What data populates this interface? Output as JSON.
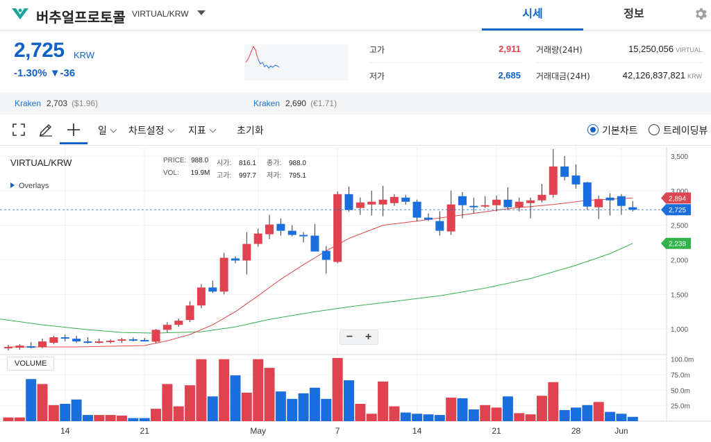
{
  "header": {
    "coin_name": "버추얼프로토콜",
    "pair": "VIRTUAL/KRW",
    "tabs": [
      {
        "label": "시세",
        "active": true
      },
      {
        "label": "정보",
        "active": false
      }
    ]
  },
  "summary": {
    "price": "2,725",
    "unit": "KRW",
    "change": "-1.30% ▼-36",
    "high_label": "고가",
    "high_value": "2,911",
    "low_label": "저가",
    "low_value": "2,685",
    "volume_label": "거래량(24H)",
    "volume_value": "15,250,056",
    "volume_unit": "VIRTUAL",
    "amount_label": "거래대금(24H)",
    "amount_value": "42,126,837,821",
    "amount_unit": "KRW"
  },
  "exchanges": [
    {
      "name": "Kraken",
      "price": "2,703",
      "usd": "($1.96)"
    },
    {
      "name": "Kraken",
      "price": "2,690",
      "usd": "(€1.71)"
    }
  ],
  "toolbar": {
    "period": "일",
    "chart_settings": "차트설정",
    "indicators": "지표",
    "reset": "초기화",
    "basic_chart": "기본차트",
    "trading_view": "트레이딩뷰"
  },
  "chart_header": {
    "symbol": "VIRTUAL/KRW",
    "overlays": "Overlays",
    "legend": {
      "price_label": "PRICE:",
      "price": "988.0",
      "open_label": "시가:",
      "open": "816.1",
      "close_label": "종가:",
      "close": "988.0",
      "vol_label": "VOL:",
      "vol": "19.9M",
      "high_label": "고가:",
      "high": "997.7",
      "low_label": "저가:",
      "low": "795.1"
    },
    "zoom_out": "−",
    "zoom_in": "+",
    "volume_tag": "VOLUME"
  },
  "colors": {
    "up": "#e0434f",
    "down": "#1b6fdd",
    "ma_short": "#e04848",
    "ma_long": "#33b24a",
    "accent": "#1261c4"
  },
  "chart_data": {
    "type": "candlestick",
    "price_axis": {
      "ticks": [
        "3,500",
        "3,000",
        "2,500",
        "2,000",
        "1,500",
        "1,000"
      ],
      "values": [
        3500,
        3000,
        2500,
        2000,
        1500,
        1000
      ],
      "range": [
        630,
        3640
      ]
    },
    "volume_axis": {
      "ticks": [
        "100.0m",
        "75.0m",
        "50.0m",
        "25.0m"
      ],
      "values": [
        100,
        75,
        50,
        25
      ],
      "range": [
        0,
        103
      ]
    },
    "x_ticks": [
      {
        "label": "14",
        "index": 5
      },
      {
        "label": "21",
        "index": 12
      },
      {
        "label": "May",
        "index": 22
      },
      {
        "label": "7",
        "index": 29
      },
      {
        "label": "14",
        "index": 36
      },
      {
        "label": "21",
        "index": 43
      },
      {
        "label": "28",
        "index": 50
      },
      {
        "label": "Jun",
        "index": 54
      }
    ],
    "current_price_label": "2,725",
    "current_price": 2725,
    "ma_short_label": "2,894",
    "ma_short_last": 2894,
    "ma_long_label": "2,238",
    "ma_long_last": 2238,
    "candles": [
      {
        "o": 720,
        "h": 770,
        "l": 690,
        "c": 740,
        "v": 6
      },
      {
        "o": 730,
        "h": 780,
        "l": 700,
        "c": 760,
        "v": 6
      },
      {
        "o": 750,
        "h": 810,
        "l": 720,
        "c": 740,
        "v": 68
      },
      {
        "o": 740,
        "h": 860,
        "l": 720,
        "c": 820,
        "v": 60
      },
      {
        "o": 800,
        "h": 900,
        "l": 780,
        "c": 880,
        "v": 26
      },
      {
        "o": 880,
        "h": 920,
        "l": 820,
        "c": 860,
        "v": 28
      },
      {
        "o": 860,
        "h": 900,
        "l": 800,
        "c": 820,
        "v": 35
      },
      {
        "o": 820,
        "h": 880,
        "l": 790,
        "c": 810,
        "v": 10
      },
      {
        "o": 810,
        "h": 860,
        "l": 790,
        "c": 820,
        "v": 10
      },
      {
        "o": 820,
        "h": 850,
        "l": 790,
        "c": 830,
        "v": 10
      },
      {
        "o": 830,
        "h": 870,
        "l": 800,
        "c": 850,
        "v": 9
      },
      {
        "o": 850,
        "h": 880,
        "l": 820,
        "c": 840,
        "v": 5
      },
      {
        "o": 840,
        "h": 870,
        "l": 820,
        "c": 835,
        "v": 5
      },
      {
        "o": 816,
        "h": 998,
        "l": 795,
        "c": 988,
        "v": 20
      },
      {
        "o": 988,
        "h": 1100,
        "l": 950,
        "c": 1060,
        "v": 60
      },
      {
        "o": 1060,
        "h": 1150,
        "l": 1030,
        "c": 1120,
        "v": 24
      },
      {
        "o": 1130,
        "h": 1400,
        "l": 1100,
        "c": 1340,
        "v": 58
      },
      {
        "o": 1340,
        "h": 1650,
        "l": 1300,
        "c": 1600,
        "v": 100
      },
      {
        "o": 1600,
        "h": 1700,
        "l": 1520,
        "c": 1540,
        "v": 40
      },
      {
        "o": 1540,
        "h": 2100,
        "l": 1500,
        "c": 2030,
        "v": 100
      },
      {
        "o": 2020,
        "h": 2050,
        "l": 1950,
        "c": 1990,
        "v": 74
      },
      {
        "o": 1990,
        "h": 2400,
        "l": 1790,
        "c": 2230,
        "v": 46
      },
      {
        "o": 2230,
        "h": 2450,
        "l": 2190,
        "c": 2380,
        "v": 100
      },
      {
        "o": 2370,
        "h": 2650,
        "l": 2300,
        "c": 2510,
        "v": 86
      },
      {
        "o": 2520,
        "h": 2600,
        "l": 2350,
        "c": 2420,
        "v": 48
      },
      {
        "o": 2420,
        "h": 2500,
        "l": 2340,
        "c": 2360,
        "v": 36
      },
      {
        "o": 2360,
        "h": 2400,
        "l": 2250,
        "c": 2350,
        "v": 45
      },
      {
        "o": 2350,
        "h": 2520,
        "l": 2300,
        "c": 2120,
        "v": 54
      },
      {
        "o": 2130,
        "h": 2200,
        "l": 1800,
        "c": 2000,
        "v": 36
      },
      {
        "o": 1970,
        "h": 2990,
        "l": 1950,
        "c": 2950,
        "v": 102
      },
      {
        "o": 2950,
        "h": 3060,
        "l": 2700,
        "c": 2720,
        "v": 66
      },
      {
        "o": 2750,
        "h": 2900,
        "l": 2650,
        "c": 2830,
        "v": 28
      },
      {
        "o": 2800,
        "h": 3000,
        "l": 2640,
        "c": 2840,
        "v": 12
      },
      {
        "o": 2800,
        "h": 3070,
        "l": 2630,
        "c": 2870,
        "v": 64
      },
      {
        "o": 2820,
        "h": 2950,
        "l": 2780,
        "c": 2910,
        "v": 24
      },
      {
        "o": 2900,
        "h": 2940,
        "l": 2800,
        "c": 2840,
        "v": 14
      },
      {
        "o": 2840,
        "h": 2870,
        "l": 2560,
        "c": 2610,
        "v": 12
      },
      {
        "o": 2610,
        "h": 2670,
        "l": 2560,
        "c": 2580,
        "v": 11
      },
      {
        "o": 2560,
        "h": 2700,
        "l": 2350,
        "c": 2420,
        "v": 10
      },
      {
        "o": 2410,
        "h": 3000,
        "l": 2360,
        "c": 2800,
        "v": 38
      },
      {
        "o": 2920,
        "h": 2980,
        "l": 2600,
        "c": 2790,
        "v": 37
      },
      {
        "o": 2780,
        "h": 2900,
        "l": 2670,
        "c": 2760,
        "v": 19
      },
      {
        "o": 2770,
        "h": 2920,
        "l": 2750,
        "c": 2790,
        "v": 26
      },
      {
        "o": 2790,
        "h": 2930,
        "l": 2700,
        "c": 2870,
        "v": 22
      },
      {
        "o": 2870,
        "h": 3050,
        "l": 2720,
        "c": 2760,
        "v": 40
      },
      {
        "o": 2760,
        "h": 2900,
        "l": 2700,
        "c": 2840,
        "v": 13
      },
      {
        "o": 2820,
        "h": 2900,
        "l": 2600,
        "c": 2860,
        "v": 11
      },
      {
        "o": 2860,
        "h": 3100,
        "l": 2830,
        "c": 2940,
        "v": 41
      },
      {
        "o": 2940,
        "h": 3600,
        "l": 2900,
        "c": 3350,
        "v": 63
      },
      {
        "o": 3350,
        "h": 3500,
        "l": 3150,
        "c": 3200,
        "v": 18
      },
      {
        "o": 3220,
        "h": 3380,
        "l": 3030,
        "c": 3090,
        "v": 22
      },
      {
        "o": 3120,
        "h": 3130,
        "l": 2720,
        "c": 2770,
        "v": 26
      },
      {
        "o": 2760,
        "h": 2930,
        "l": 2590,
        "c": 2880,
        "v": 31
      },
      {
        "o": 2900,
        "h": 2960,
        "l": 2640,
        "c": 2860,
        "v": 15
      },
      {
        "o": 2920,
        "h": 2950,
        "l": 2650,
        "c": 2780,
        "v": 12
      },
      {
        "o": 2760,
        "h": 2850,
        "l": 2700,
        "c": 2725,
        "v": 7
      }
    ],
    "ma_short": [
      {
        "i": 0,
        "v": 740
      },
      {
        "i": 6,
        "v": 740
      },
      {
        "i": 12,
        "v": 760
      },
      {
        "i": 14,
        "v": 830
      },
      {
        "i": 16,
        "v": 920
      },
      {
        "i": 18,
        "v": 1060
      },
      {
        "i": 20,
        "v": 1250
      },
      {
        "i": 22,
        "v": 1480
      },
      {
        "i": 24,
        "v": 1720
      },
      {
        "i": 26,
        "v": 1930
      },
      {
        "i": 28,
        "v": 2130
      },
      {
        "i": 30,
        "v": 2310
      },
      {
        "i": 33,
        "v": 2500
      },
      {
        "i": 36,
        "v": 2560
      },
      {
        "i": 40,
        "v": 2650
      },
      {
        "i": 44,
        "v": 2740
      },
      {
        "i": 48,
        "v": 2800
      },
      {
        "i": 51,
        "v": 2860
      },
      {
        "i": 55,
        "v": 2894
      }
    ],
    "ma_long": [
      {
        "i": -1,
        "v": 1150
      },
      {
        "i": 3,
        "v": 1060
      },
      {
        "i": 7,
        "v": 990
      },
      {
        "i": 10,
        "v": 950
      },
      {
        "i": 13,
        "v": 940
      },
      {
        "i": 17,
        "v": 960
      },
      {
        "i": 20,
        "v": 1030
      },
      {
        "i": 23,
        "v": 1140
      },
      {
        "i": 27,
        "v": 1250
      },
      {
        "i": 30,
        "v": 1320
      },
      {
        "i": 34,
        "v": 1400
      },
      {
        "i": 38,
        "v": 1480
      },
      {
        "i": 42,
        "v": 1590
      },
      {
        "i": 46,
        "v": 1730
      },
      {
        "i": 50,
        "v": 1920
      },
      {
        "i": 53,
        "v": 2090
      },
      {
        "i": 55,
        "v": 2238
      }
    ]
  }
}
